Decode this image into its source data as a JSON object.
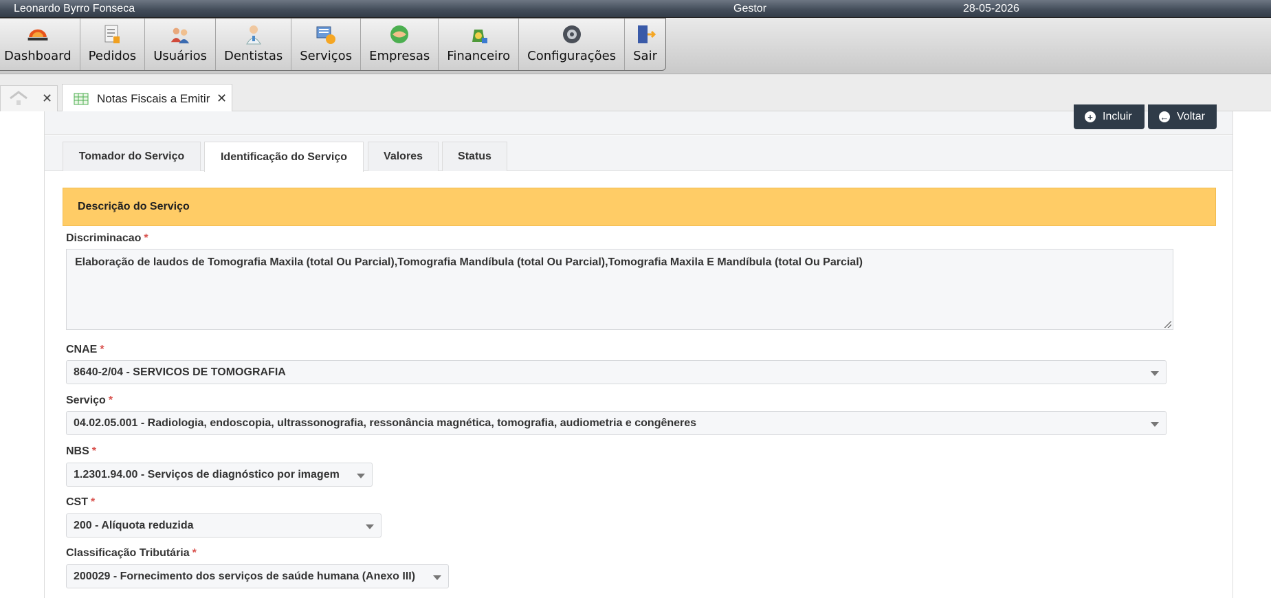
{
  "topbar": {
    "user": "Leonardo Byrro Fonseca",
    "role": "Gestor",
    "date": "28-05-2026"
  },
  "menu": [
    {
      "label": "Dashboard",
      "icon": "diagnosis-logo-icon"
    },
    {
      "label": "Pedidos",
      "icon": "document-icon"
    },
    {
      "label": "Usuários",
      "icon": "users-icon"
    },
    {
      "label": "Dentistas",
      "icon": "dentist-icon"
    },
    {
      "label": "Serviços",
      "icon": "services-icon"
    },
    {
      "label": "Empresas",
      "icon": "handshake-icon"
    },
    {
      "label": "Financeiro",
      "icon": "money-bag-icon"
    },
    {
      "label": "Configurações",
      "icon": "settings-icon"
    },
    {
      "label": "Sair",
      "icon": "exit-door-icon"
    }
  ],
  "tabs": {
    "doc_title": "Notas Fiscais a Emitir",
    "close": "✕"
  },
  "actions": {
    "incluir": "Incluir",
    "voltar": "Voltar"
  },
  "form_tabs": [
    "Tomador do Serviço",
    "Identificação do Serviço",
    "Valores",
    "Status"
  ],
  "active_form_tab": "Identificação do Serviço",
  "section": {
    "title": "Descrição do Serviço"
  },
  "fields": {
    "discriminacao": {
      "label": "Discriminacao",
      "value": "Elaboração de laudos de Tomografia Maxila (total Ou Parcial),Tomografia Mandíbula (total Ou Parcial),Tomografia Maxila E Mandíbula (total Ou Parcial)"
    },
    "cnae": {
      "label": "CNAE",
      "value": "8640-2/04 - SERVICOS DE TOMOGRAFIA"
    },
    "servico": {
      "label": "Serviço",
      "value": "04.02.05.001 - Radiologia, endoscopia, ultrassonografia, ressonância magnética, tomografia, audiometria e congêneres"
    },
    "nbs": {
      "label": "NBS",
      "value": "1.2301.94.00 - Serviços de diagnóstico por imagem"
    },
    "cst": {
      "label": "CST",
      "value": "200 - Alíquota reduzida"
    },
    "classificacao": {
      "label": "Classificação Tributária",
      "value": "200029 - Fornecimento dos serviços de saúde humana (Anexo III)"
    },
    "required_mark": "*"
  },
  "colors": {
    "accent_section": "#ffcc66",
    "dark_button": "#2f3b48",
    "required": "#d9534f"
  }
}
